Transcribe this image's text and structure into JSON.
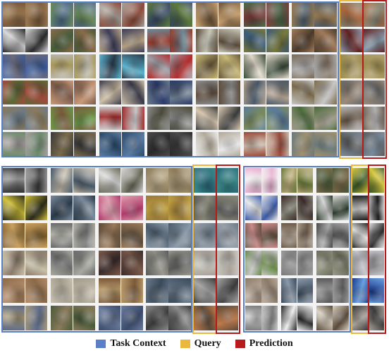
{
  "legend": {
    "task_context": {
      "label": "Task Context",
      "color": "#5b7fc7"
    },
    "query": {
      "label": "Query",
      "color": "#e8b93c"
    },
    "prediction": {
      "label": "Prediction",
      "color": "#b81a1a"
    }
  },
  "panels": [
    {
      "id": "top",
      "rows": 6,
      "pairs": 8,
      "query_pairs": [
        7
      ],
      "palettes": [
        [
          "#7a5a3c",
          "#9b7a52",
          "#6b8a58",
          "#4e6b8a",
          "#8c4a3a",
          "#a8a29a",
          "#5c7a3a",
          "#3a4a66",
          "#c8a070",
          "#70583c",
          "#4a6a4a",
          "#7a3a3a",
          "#96784e",
          "#506070",
          "#8a8a7a",
          "#a8643a"
        ],
        [
          "#2a2a2a",
          "#d8d8d8",
          "#8a6a4a",
          "#445c3a",
          "#b4a080",
          "#3c3c5a",
          "#6a8a9a",
          "#9a3a2a",
          "#5a4a3a",
          "#c8c8b8",
          "#7a7a3a",
          "#3a5a7a",
          "#a07a5a",
          "#4a3a2a",
          "#8aa0b0",
          "#602020"
        ],
        [
          "#3a5a9a",
          "#6a6a7a",
          "#b8b4a8",
          "#a8985a",
          "#5ab4d0",
          "#2a3a4a",
          "#b42a2a",
          "#9aa0a8",
          "#c8b878",
          "#6a5a3a",
          "#3a4a3a",
          "#e0d8c8",
          "#7a6a5a",
          "#a8a8a8",
          "#9a8a4a",
          "#b0a070"
        ],
        [
          "#a04a3a",
          "#5a6a3a",
          "#c89a7a",
          "#7a5a4a",
          "#3a3a4a",
          "#d0c0a8",
          "#6a7a8a",
          "#2a3a6a",
          "#8a8a8a",
          "#5a4a3a",
          "#b0a090",
          "#4a5a6a",
          "#c8c8c8",
          "#7a6a4a",
          "#6a6a6a",
          "#9a8a7a"
        ],
        [
          "#8a7a5a",
          "#6a7a8a",
          "#6a9a4a",
          "#7a5a3a",
          "#c8c8c8",
          "#a02a2a",
          "#8a8a8a",
          "#4a4a3a",
          "#3a3a3a",
          "#d8c8b0",
          "#5a7a9a",
          "#7a8a5a",
          "#a09a8a",
          "#4a6a3a",
          "#b0b0b0",
          "#6a5a4a"
        ],
        [
          "#6a8a6a",
          "#a8a0a0",
          "#3a3a3a",
          "#7a6a4a",
          "#5a7aa0",
          "#2a4a6a",
          "#4a4a4a",
          "#2a2a2a",
          "#e8e8e8",
          "#b0a898",
          "#9a4a3a",
          "#c8b8a8",
          "#6a7a7a",
          "#a09070",
          "#7a8a9a",
          "#5a5a5a"
        ]
      ]
    },
    {
      "id": "bottom-left",
      "rows": 6,
      "pairs": 5,
      "query_pairs": [
        4
      ],
      "palettes": [
        [
          "#3a3a3a",
          "#9a9a9a",
          "#4a5a6a",
          "#c8c0b0",
          "#6a6a5a",
          "#d8d8d8",
          "#8a7a5a",
          "#b8a888",
          "#3a8a8a",
          "#2a6a7a"
        ],
        [
          "#2a2a1a",
          "#d0c03a",
          "#7a8a9a",
          "#2a3a4a",
          "#b03a6a",
          "#e0a0b0",
          "#9a7a3a",
          "#c0a040",
          "#5a5a5a",
          "#8a8a7a"
        ],
        [
          "#7a5a2a",
          "#c8a060",
          "#6a6a6a",
          "#b0b0a8",
          "#5a4a3a",
          "#9a7a5a",
          "#8a9aa8",
          "#4a5a6a",
          "#9aa0a8",
          "#6a7a88"
        ],
        [
          "#c8c0a8",
          "#8a7a6a",
          "#a8a8a0",
          "#6a6a6a",
          "#7a5a4a",
          "#3a2a2a",
          "#5a5a5a",
          "#9a9a90",
          "#a8a098",
          "#c8c8c0"
        ],
        [
          "#8a6a4a",
          "#b08a6a",
          "#c8c0b0",
          "#a09a8a",
          "#7a5a3a",
          "#b89a6a",
          "#6a7a8a",
          "#3a4a5a",
          "#3a3a3a",
          "#a8a8a8"
        ],
        [
          "#5a6a8a",
          "#a89a7a",
          "#4a5a3a",
          "#8a7a5a",
          "#3a4a6a",
          "#6a7a9a",
          "#8a8a8a",
          "#3a3a3a",
          "#c07a4a",
          "#5a4a3a"
        ]
      ]
    },
    {
      "id": "bottom-right",
      "rows": 6,
      "pairs": 4,
      "query_pairs": [
        3
      ],
      "palettes": [
        [
          "#e8b0d0",
          "#f0f0f0",
          "#6a7a3a",
          "#c0b080",
          "#7a6a4a",
          "#4a5a3a",
          "#d8c840",
          "#3a5a2a"
        ],
        [
          "#3a5aa8",
          "#e8e8e8",
          "#3a2a2a",
          "#8a8a7a",
          "#2a3a2a",
          "#d8d8d8",
          "#1a1a1a",
          "#c8c8c8"
        ],
        [
          "#5a4a3a",
          "#c88a8a",
          "#6a5a4a",
          "#a8988a",
          "#4a4a4a",
          "#a8a8a8",
          "#2a2a2a",
          "#e0e0e0"
        ],
        [
          "#6a8a4a",
          "#c8c8c8",
          "#7a7a7a",
          "#a0a0a0",
          "#6a6a5a",
          "#9a9a88",
          "#8a8a8a",
          "#c8c8d0"
        ],
        [
          "#8a7a6a",
          "#b8a898",
          "#3a4a5a",
          "#8a98a8",
          "#5a5a5a",
          "#9a9a9a",
          "#1a3a8a",
          "#6aa0e0"
        ],
        [
          "#7a7a7a",
          "#c8c8c8",
          "#2a2a2a",
          "#f0f0f0",
          "#5a4a3a",
          "#d8d0c0",
          "#3a3a3a",
          "#a8a098"
        ]
      ]
    }
  ]
}
